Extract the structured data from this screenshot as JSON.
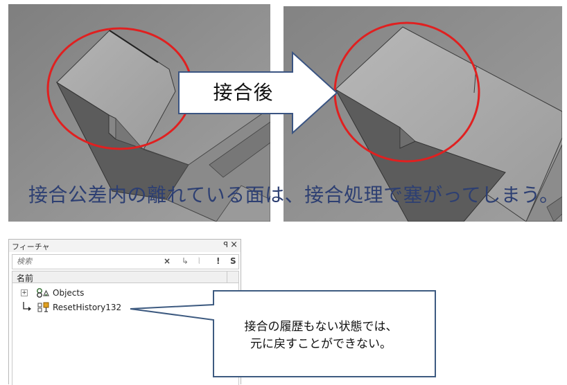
{
  "transition": {
    "label": "接合後"
  },
  "caption": "接合公差内の離れている面は、接合処理で塞がってしまう。",
  "feature_panel": {
    "title": "フィーチャ",
    "pin_glyph": "ꟼ",
    "close_glyph": "×",
    "search": {
      "placeholder": "検索",
      "value": ""
    },
    "search_tools": {
      "clear": "×",
      "filter_down": "↳",
      "filter_tree": "⦚",
      "alert": "!",
      "s": "S"
    },
    "column_header": "名前",
    "tree": [
      {
        "expander": "+",
        "label": "Objects",
        "icon": "objects-icon"
      },
      {
        "label": "ResetHistory132",
        "icon": "reset-history-icon"
      }
    ]
  },
  "callout": {
    "lines": [
      "接合の履歴もない状態では、",
      "元に戻すことができない。"
    ]
  },
  "colors": {
    "highlight_circle": "#e02020",
    "caption_text": "#2d3f72",
    "callout_border": "#3d5a80",
    "arrow_border": "#3a5482",
    "viewport_bg": "#8f8f8f"
  }
}
